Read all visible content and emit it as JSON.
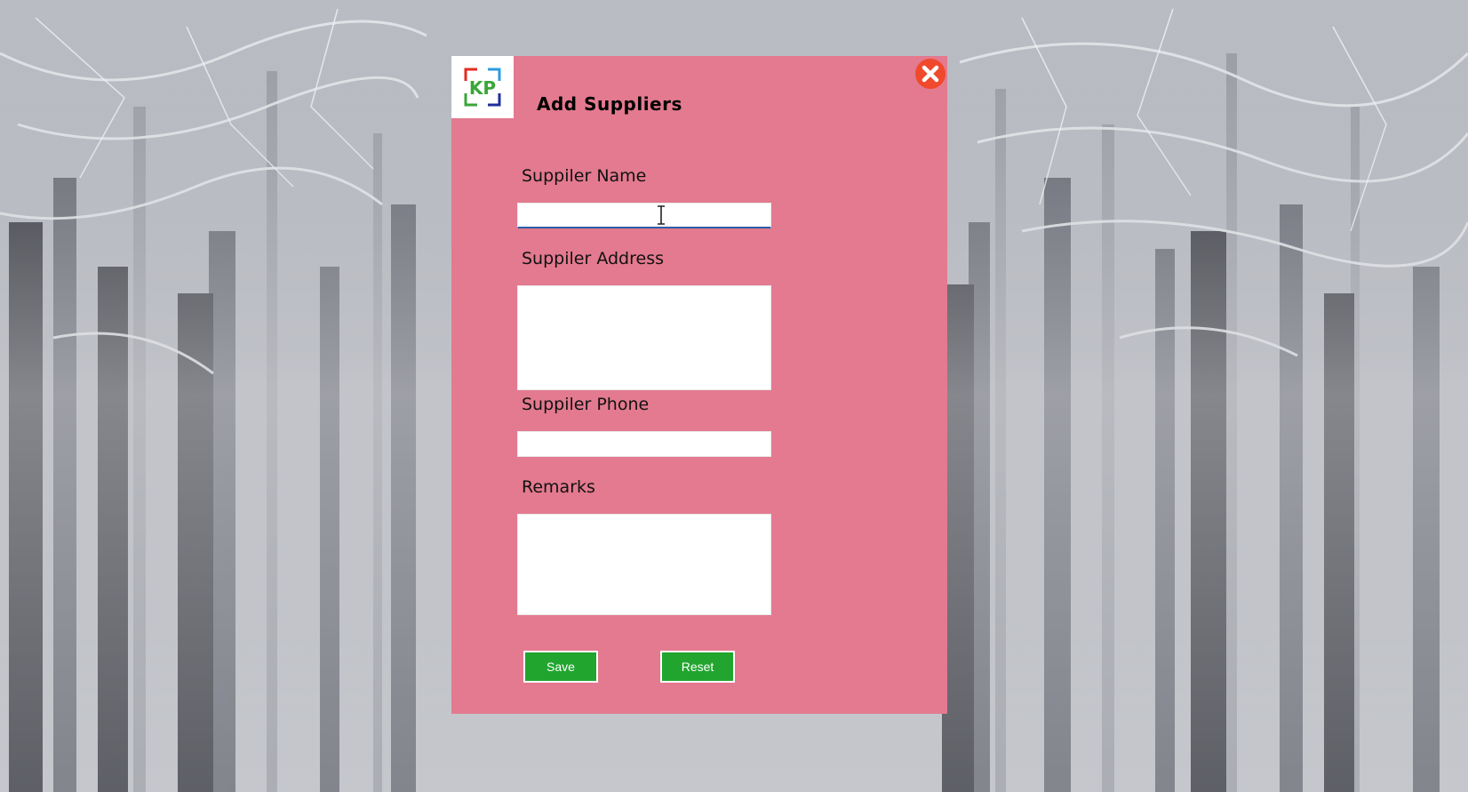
{
  "dialog": {
    "title": "Add Suppliers",
    "logo_text": "KP",
    "background_color": "#e37a8f",
    "close_icon": "close-icon"
  },
  "form": {
    "supplier_name": {
      "label": "Suppiler Name",
      "value": ""
    },
    "supplier_address": {
      "label": "Suppiler Address",
      "value": ""
    },
    "supplier_phone": {
      "label": "Suppiler Phone",
      "value": ""
    },
    "remarks": {
      "label": "Remarks",
      "value": ""
    }
  },
  "buttons": {
    "save_label": "Save",
    "reset_label": "Reset",
    "button_color": "#21a52f"
  }
}
